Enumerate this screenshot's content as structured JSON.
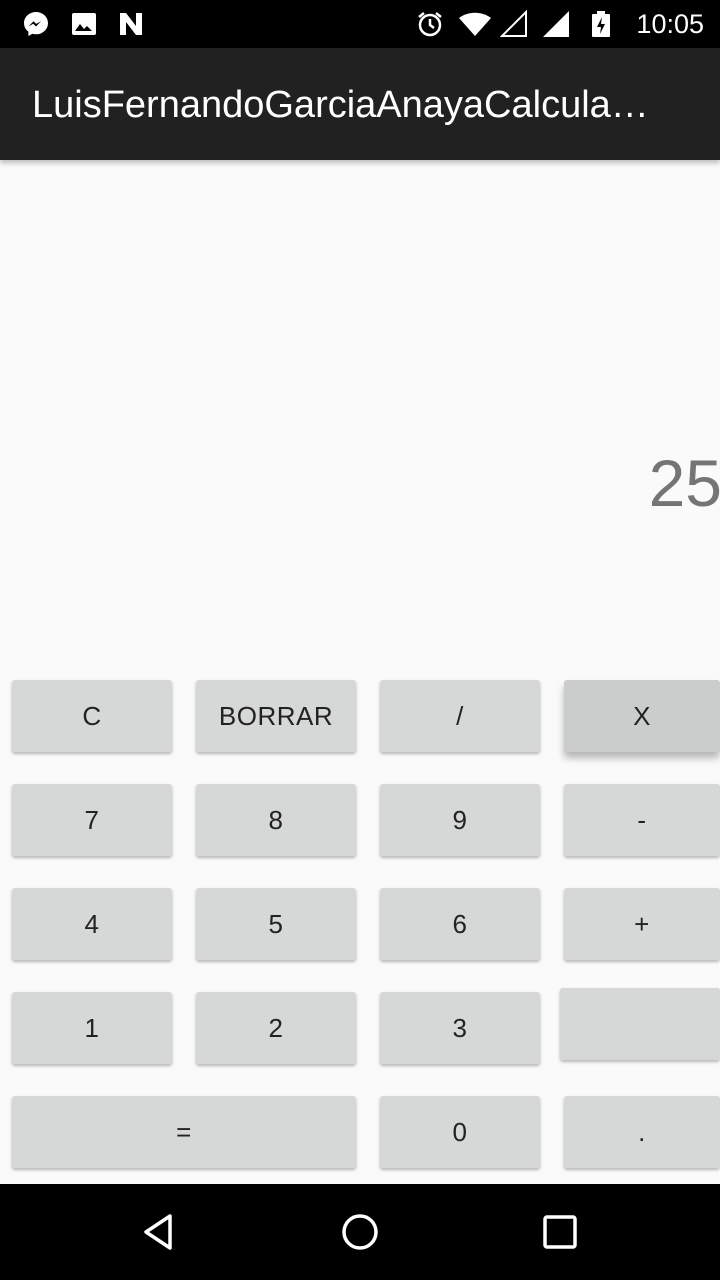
{
  "status_bar": {
    "time": "10:05",
    "left_icons": [
      "messenger-icon",
      "image-icon",
      "n-notification-icon"
    ],
    "right_icons": [
      "alarm-icon",
      "wifi-icon",
      "signal-empty-icon",
      "signal-icon",
      "battery-charging-icon"
    ]
  },
  "action_bar": {
    "title": "LuisFernandoGarciaAnayaCalcula…"
  },
  "display": {
    "value": "25"
  },
  "keypad": {
    "row1": [
      "C",
      "BORRAR",
      "/",
      "X"
    ],
    "row2": [
      "7",
      "8",
      "9",
      "-"
    ],
    "row3": [
      "4",
      "5",
      "6",
      "+"
    ],
    "row4": [
      "1",
      "2",
      "3",
      ""
    ],
    "row5": [
      "=",
      "0",
      "."
    ]
  },
  "nav_bar": {
    "icons": [
      "back-icon",
      "home-icon",
      "recents-icon"
    ]
  },
  "colors": {
    "status_bar": "#000000",
    "action_bar": "#212121",
    "background": "#fafafa",
    "key": "#d6d7d7",
    "display_text": "#757575"
  }
}
